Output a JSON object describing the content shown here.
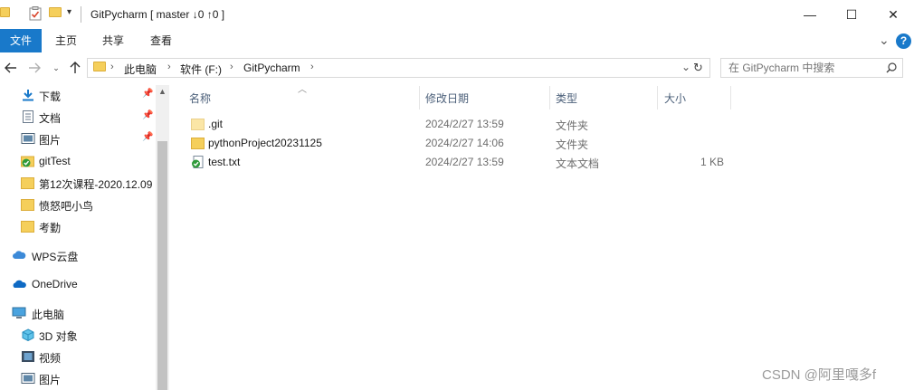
{
  "window": {
    "title": "GitPycharm [ master ↓0 ↑0 ]",
    "controls": {
      "minimize": "—",
      "maximize": "☐",
      "close": "✕"
    }
  },
  "ribbon": {
    "tabs": [
      {
        "label": "文件",
        "active": true
      },
      {
        "label": "主页"
      },
      {
        "label": "共享"
      },
      {
        "label": "查看"
      }
    ],
    "expand_glyph": "⌄",
    "help_glyph": "?"
  },
  "address": {
    "crumbs": [
      "此电脑",
      "软件 (F:)",
      "GitPycharm"
    ],
    "search_placeholder": "在 GitPycharm 中搜索"
  },
  "nav_pane": {
    "items": [
      {
        "label": "下载",
        "icon": "download-icon",
        "pinned": true
      },
      {
        "label": "文档",
        "icon": "document-icon",
        "pinned": true
      },
      {
        "label": "图片",
        "icon": "picture-icon",
        "pinned": true
      },
      {
        "label": "gitTest",
        "icon": "git-folder-icon",
        "pinned": false
      },
      {
        "label": "第12次课程-2020.12.09",
        "icon": "folder-icon",
        "pinned": false
      },
      {
        "label": "愤怒吧小鸟",
        "icon": "folder-icon",
        "pinned": false
      },
      {
        "label": "考勤",
        "icon": "folder-icon",
        "pinned": false
      },
      {
        "label": "WPS云盘",
        "icon": "cloud-icon",
        "pinned": false
      },
      {
        "label": "OneDrive",
        "icon": "onedrive-icon",
        "pinned": false
      },
      {
        "label": "此电脑",
        "icon": "computer-icon",
        "pinned": false
      },
      {
        "label": "3D 对象",
        "icon": "3d-objects-icon",
        "pinned": false
      },
      {
        "label": "视频",
        "icon": "video-icon",
        "pinned": false
      },
      {
        "label": "图片",
        "icon": "picture-icon",
        "pinned": false
      }
    ]
  },
  "file_list": {
    "columns": [
      "名称",
      "修改日期",
      "类型",
      "大小"
    ],
    "rows": [
      {
        "name": ".git",
        "date": "2024/2/27 13:59",
        "type": "文件夹",
        "size": "",
        "icon": "folder-icon"
      },
      {
        "name": "pythonProject20231125",
        "date": "2024/2/27 14:06",
        "type": "文件夹",
        "size": "",
        "icon": "folder-icon"
      },
      {
        "name": "test.txt",
        "date": "2024/2/27 13:59",
        "type": "文本文档",
        "size": "1 KB",
        "icon": "git-text-file-icon"
      }
    ]
  },
  "watermark": "CSDN @阿里嘎多f",
  "colors": {
    "accent": "#1979ca",
    "folder": "#f5cf5b",
    "git_check": "#2e9a3a",
    "header_text": "#4c607a"
  }
}
